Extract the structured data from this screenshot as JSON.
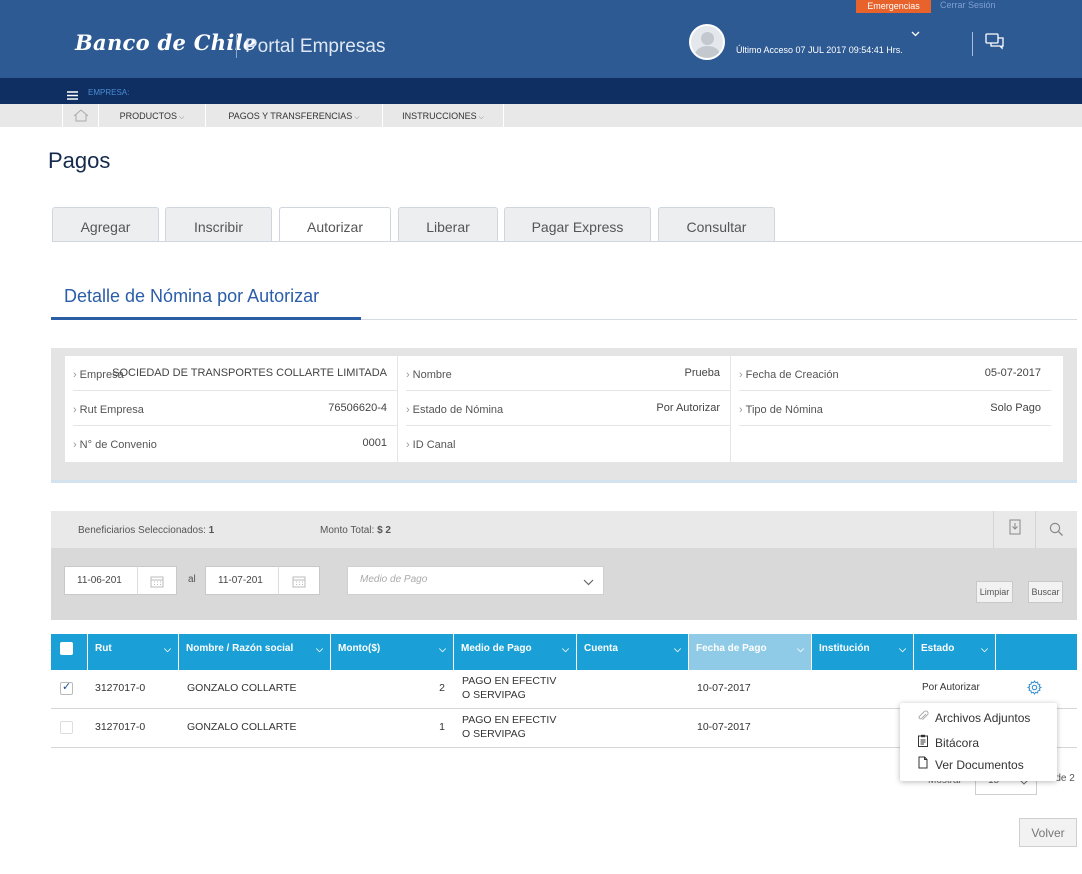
{
  "header": {
    "bank_name": "Banco de Chile",
    "portal_name": "Portal Empresas",
    "emergencias_label": "Emergencias",
    "logout_label": "Cerrar Sesión",
    "last_access": "Último Acceso 07 JUL 2017 09:54:41 Hrs.",
    "empresa_label": "EMPRESA:"
  },
  "nav": {
    "items": [
      {
        "label": "PRODUCTOS"
      },
      {
        "label": "PAGOS Y TRANSFERENCIAS"
      },
      {
        "label": "INSTRUCCIONES"
      }
    ]
  },
  "page": {
    "title": "Pagos",
    "tabs": [
      {
        "label": "Agregar"
      },
      {
        "label": "Inscribir"
      },
      {
        "label": "Autorizar",
        "active": true
      },
      {
        "label": "Liberar"
      },
      {
        "label": "Pagar Express"
      },
      {
        "label": "Consultar"
      }
    ],
    "section_title": "Detalle de Nómina por Autorizar"
  },
  "details": {
    "empresa": {
      "label": "Empresa",
      "value": "SOCIEDAD DE TRANSPORTES COLLARTE LIMITADA"
    },
    "nombre": {
      "label": "Nombre",
      "value": "Prueba"
    },
    "fecha_creacion": {
      "label": "Fecha de Creación",
      "value": "05-07-2017"
    },
    "rut_empresa": {
      "label": "Rut Empresa",
      "value": "76506620-4"
    },
    "estado_nomina": {
      "label": "Estado de Nómina",
      "value": "Por Autorizar"
    },
    "tipo_nomina": {
      "label": "Tipo de Nómina",
      "value": "Solo Pago"
    },
    "convenio": {
      "label": "N° de Convenio",
      "value": "0001"
    },
    "id_canal": {
      "label": "ID Canal",
      "value": ""
    }
  },
  "summary": {
    "beneficiarios_label": "Beneficiarios Seleccionados:",
    "beneficiarios_value": "1",
    "monto_label": "Monto Total:",
    "monto_value": "$ 2"
  },
  "filters": {
    "date_from": "11-06-201",
    "al_label": "al",
    "date_to": "11-07-201",
    "medio_placeholder": "Medio de Pago",
    "limpiar_label": "Limpiar",
    "buscar_label": "Buscar"
  },
  "table": {
    "columns": [
      "Rut",
      "Nombre / Razón social",
      "Monto($)",
      "Medio de Pago",
      "Cuenta",
      "Fecha de Pago",
      "Institución",
      "Estado"
    ],
    "rows": [
      {
        "checked": true,
        "rut": "3127017-0",
        "nombre": "GONZALO COLLARTE",
        "monto": "2",
        "medio_1": "PAGO EN EFECTIV",
        "medio_2": "O SERVIPAG",
        "cuenta": "",
        "fecha": "10-07-2017",
        "institucion": "",
        "estado": "Por Autorizar"
      },
      {
        "checked": false,
        "rut": "3127017-0",
        "nombre": "GONZALO COLLARTE",
        "monto": "1",
        "medio_1": "PAGO EN EFECTIV",
        "medio_2": "O SERVIPAG",
        "cuenta": "",
        "fecha": "10-07-2017",
        "institucion": "",
        "estado": ""
      }
    ]
  },
  "context_menu": {
    "items": [
      {
        "label": "Archivos Adjuntos",
        "icon": "paperclip-icon"
      },
      {
        "label": "Bitácora",
        "icon": "clipboard-icon"
      },
      {
        "label": "Ver Documentos",
        "icon": "document-icon"
      }
    ]
  },
  "pagination": {
    "mostrar_label": "Mostrar",
    "per_page": "15",
    "page_info": "2 de 2"
  },
  "footer": {
    "volver_label": "Volver"
  },
  "colors": {
    "header_blue": "#2d5a93",
    "navy": "#0f2f62",
    "table_header": "#1aa0d6",
    "emergency": "#e8622b"
  }
}
